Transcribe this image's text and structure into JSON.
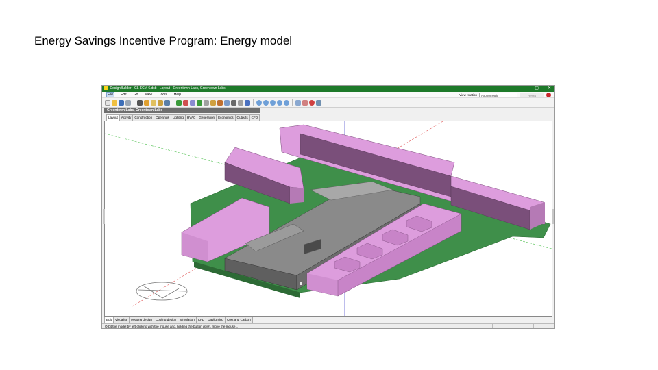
{
  "slide": {
    "title": "Energy Savings Incentive Program: Energy model"
  },
  "window": {
    "app_name": "DesignBuilder",
    "title": "DesignBuilder - GL ECM 6.dsb - Layout - Greentown Labs, Greentown Labs",
    "controls": {
      "minimize": "–",
      "maximize": "▢",
      "close": "✕"
    }
  },
  "menu": {
    "items": [
      "File",
      "Edit",
      "Go",
      "View",
      "Tools",
      "Help"
    ],
    "active_index": 0,
    "view_rotation_label": "View rotation",
    "view_mode": "Axonometric",
    "reset_label": "Reset"
  },
  "breadcrumb": "Greentown Labs, Greentown Labs",
  "top_tabs": {
    "items": [
      "Layout",
      "Activity",
      "Construction",
      "Openings",
      "Lighting",
      "HVAC",
      "Generation",
      "Economics",
      "Outputs",
      "CFD"
    ],
    "active_index": 0
  },
  "bottom_tabs": {
    "items": [
      "Edit",
      "Visualise",
      "Heating design",
      "Cooling design",
      "Simulation",
      "CFD",
      "Daylighting",
      "Cost and Carbon"
    ],
    "active_index": 0
  },
  "status": {
    "text": "Orbit the model by left-clicking with the mouse and, holding the button down, move the mouse..."
  },
  "colors": {
    "titlebar": "#1e7a2a",
    "neighbour_block": "#dd9ddd",
    "ground": "#3f8f4a",
    "building": "#8a8a8a",
    "axis_red": "#e05050",
    "axis_green": "#40c040",
    "axis_blue": "#5050d0"
  }
}
